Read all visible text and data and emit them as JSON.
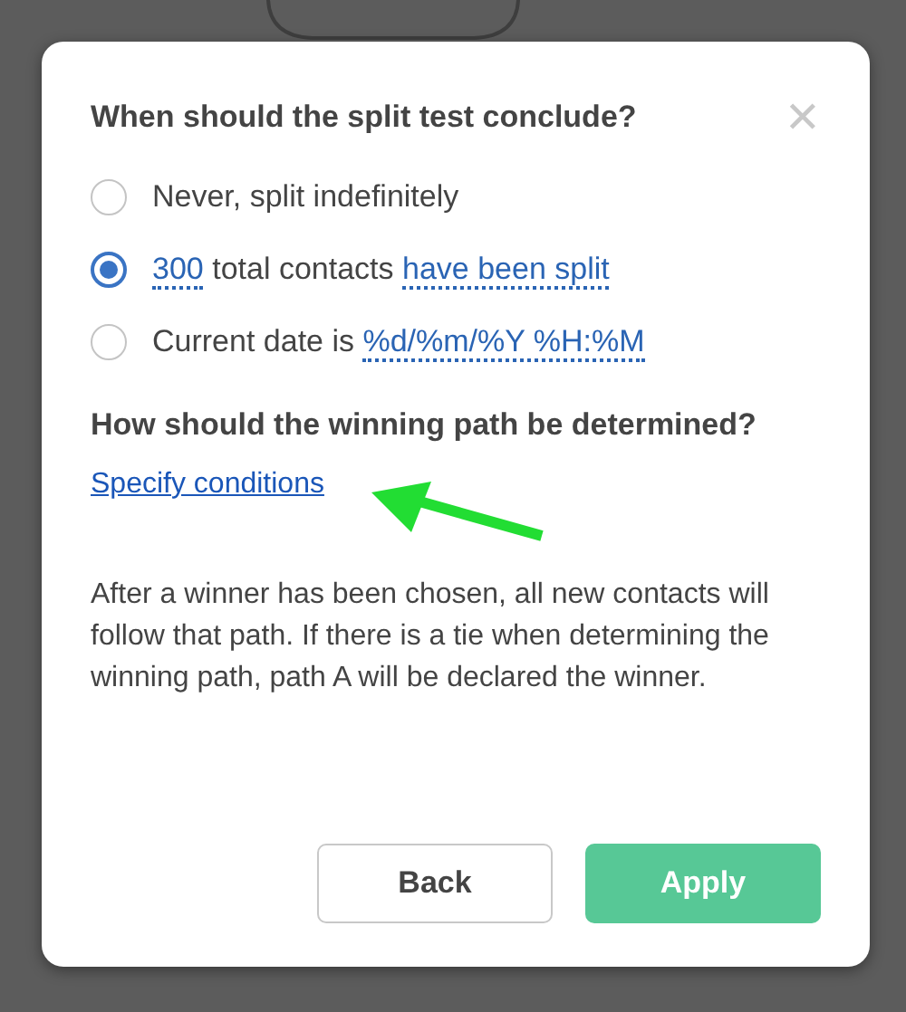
{
  "dialog": {
    "title": "When should the split test conclude?",
    "close_icon": "✕",
    "options": [
      {
        "selected": false,
        "parts": [
          {
            "kind": "text",
            "text": "Never, split indefinitely"
          }
        ]
      },
      {
        "selected": true,
        "parts": [
          {
            "kind": "link",
            "text": "300"
          },
          {
            "kind": "text",
            "text": " total contacts "
          },
          {
            "kind": "link",
            "text": "have been split"
          }
        ]
      },
      {
        "selected": false,
        "parts": [
          {
            "kind": "text",
            "text": "Current date is "
          },
          {
            "kind": "link",
            "text": "%d/%m/%Y %H:%M"
          }
        ]
      }
    ],
    "winner_heading": "How should the winning path be determined?",
    "conditions_link": "Specify conditions",
    "description": "After a winner has been chosen, all new contacts will follow that path. If there is a tie when determining the winning path, path A will be declared the winner.",
    "buttons": [
      {
        "kind": "secondary",
        "label": "Back"
      },
      {
        "kind": "primary",
        "label": "Apply"
      }
    ]
  }
}
